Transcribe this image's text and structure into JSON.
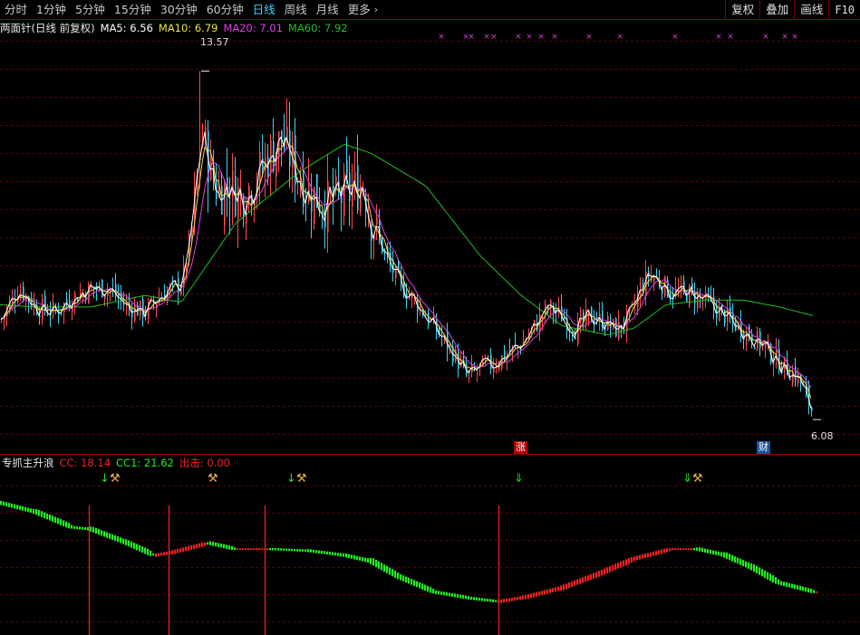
{
  "toolbar": {
    "timeframes": [
      {
        "label": "分时",
        "active": false
      },
      {
        "label": "1分钟",
        "active": false
      },
      {
        "label": "5分钟",
        "active": false
      },
      {
        "label": "15分钟",
        "active": false
      },
      {
        "label": "30分钟",
        "active": false
      },
      {
        "label": "60分钟",
        "active": false
      },
      {
        "label": "日线",
        "active": true
      },
      {
        "label": "周线",
        "active": false
      },
      {
        "label": "月线",
        "active": false
      }
    ],
    "more_label": "更多",
    "more_chevron": "›",
    "right_buttons": [
      "复权",
      "叠加",
      "画线",
      "F10"
    ]
  },
  "main_legend": {
    "name": "两面针(日线 前复权)",
    "ma5": "MA5: 6.56",
    "ma10": "MA10: 6.79",
    "ma20": "MA20: 7.01",
    "ma60": "MA60: 7.92"
  },
  "price_labels": {
    "high": "13.57",
    "low": "6.08"
  },
  "events": {
    "zhang": "涨",
    "cai": "财"
  },
  "sub_legend": {
    "name": "专抓主升浪",
    "cc": "CC: 18.14",
    "cc1": "CC1: 21.62",
    "chuji": "出击: 0.00"
  },
  "signals": [
    {
      "g": "↓",
      "y": "⚒"
    },
    {
      "g": "",
      "y": "⚒"
    },
    {
      "g": "↓",
      "y": "⚒"
    },
    {
      "g": "⇓",
      "y": ""
    },
    {
      "g": "⇓",
      "y": "⚒"
    }
  ],
  "colors": {
    "up_candle": "#ff4a4a",
    "down_candle": "#3ad3f5",
    "ma5": "#ffffff",
    "ma10": "#e8e04a",
    "ma20": "#e040e8",
    "ma60": "#20c020",
    "grid": "#5a0000",
    "osc_up": "#ee2222",
    "osc_down": "#22ee22",
    "pulse": "#dd2222"
  },
  "chart_data": {
    "type": "candlestick",
    "ma60_anchors": [
      [
        0,
        8.55
      ],
      [
        40,
        8.5
      ],
      [
        100,
        8.5
      ],
      [
        160,
        8.75
      ],
      [
        200,
        8.6
      ],
      [
        260,
        10.3
      ],
      [
        330,
        11.4
      ],
      [
        380,
        12.0
      ],
      [
        410,
        11.8
      ],
      [
        470,
        11.1
      ],
      [
        530,
        9.6
      ],
      [
        575,
        8.75
      ],
      [
        620,
        8.1
      ],
      [
        670,
        7.9
      ],
      [
        700,
        8.05
      ],
      [
        735,
        8.55
      ],
      [
        780,
        8.65
      ],
      [
        820,
        8.65
      ],
      [
        860,
        8.5
      ],
      [
        900,
        8.3
      ]
    ],
    "price_path": [
      [
        0,
        8.2
      ],
      [
        20,
        8.9
      ],
      [
        40,
        8.5
      ],
      [
        60,
        8.4
      ],
      [
        80,
        8.7
      ],
      [
        100,
        8.9
      ],
      [
        120,
        8.9
      ],
      [
        140,
        8.5
      ],
      [
        160,
        8.4
      ],
      [
        180,
        8.8
      ],
      [
        200,
        9.0
      ],
      [
        212,
        10.3
      ],
      [
        222,
        12.3
      ],
      [
        232,
        11.4
      ],
      [
        240,
        11.0
      ],
      [
        252,
        11.1
      ],
      [
        265,
        10.9
      ],
      [
        280,
        11.2
      ],
      [
        295,
        11.7
      ],
      [
        310,
        12.1
      ],
      [
        325,
        11.5
      ],
      [
        340,
        11.0
      ],
      [
        360,
        10.7
      ],
      [
        380,
        10.9
      ],
      [
        390,
        11.0
      ],
      [
        400,
        11.2
      ],
      [
        410,
        10.3
      ],
      [
        425,
        9.6
      ],
      [
        440,
        9.0
      ],
      [
        455,
        8.7
      ],
      [
        470,
        8.3
      ],
      [
        485,
        7.9
      ],
      [
        500,
        7.5
      ],
      [
        515,
        7.0
      ],
      [
        530,
        7.2
      ],
      [
        545,
        7.3
      ],
      [
        560,
        7.5
      ],
      [
        575,
        7.7
      ],
      [
        590,
        8.1
      ],
      [
        605,
        8.5
      ],
      [
        620,
        8.3
      ],
      [
        635,
        8.0
      ],
      [
        650,
        8.3
      ],
      [
        665,
        8.2
      ],
      [
        680,
        8.0
      ],
      [
        695,
        8.3
      ],
      [
        705,
        8.8
      ],
      [
        715,
        9.2
      ],
      [
        725,
        9.1
      ],
      [
        740,
        8.8
      ],
      [
        760,
        8.8
      ],
      [
        780,
        8.6
      ],
      [
        800,
        8.3
      ],
      [
        820,
        8.0
      ],
      [
        840,
        7.7
      ],
      [
        860,
        7.3
      ],
      [
        880,
        7.0
      ],
      [
        897,
        6.2
      ]
    ],
    "high": 13.57,
    "low": 6.08,
    "oscillator_path": [
      [
        0,
        22.4
      ],
      [
        40,
        21.8
      ],
      [
        80,
        20.8
      ],
      [
        100,
        20.7
      ],
      [
        140,
        19.8
      ],
      [
        170,
        19.0
      ],
      [
        190,
        19.2
      ],
      [
        230,
        19.8
      ],
      [
        260,
        19.4
      ],
      [
        300,
        19.4
      ],
      [
        340,
        19.3
      ],
      [
        380,
        19.0
      ],
      [
        410,
        18.6
      ],
      [
        440,
        17.6
      ],
      [
        480,
        16.6
      ],
      [
        520,
        16.2
      ],
      [
        550,
        16.0
      ],
      [
        580,
        16.3
      ],
      [
        620,
        16.9
      ],
      [
        660,
        17.8
      ],
      [
        700,
        18.8
      ],
      [
        740,
        19.4
      ],
      [
        770,
        19.4
      ],
      [
        800,
        19.0
      ],
      [
        830,
        18.2
      ],
      [
        860,
        17.2
      ],
      [
        900,
        16.6
      ]
    ],
    "pulse_x": [
      98,
      186,
      292,
      550
    ],
    "oscillator_range": [
      14,
      24
    ]
  }
}
